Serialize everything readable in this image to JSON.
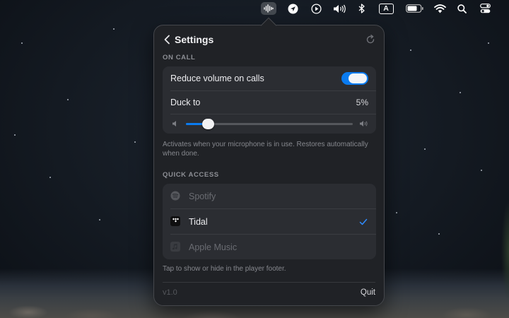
{
  "menubar": {
    "input_source": "A",
    "active_item": "audio-waveform-icon"
  },
  "popover": {
    "title": "Settings",
    "on_call": {
      "section_label": "ON CALL",
      "reduce_volume_label": "Reduce volume on calls",
      "reduce_volume_enabled": true,
      "duck_to_label": "Duck to",
      "duck_to_value": "5%",
      "duck_level_fraction": 0.13,
      "help_text": "Activates when your microphone is in use. Restores automatically when done."
    },
    "quick_access": {
      "section_label": "QUICK ACCESS",
      "items": [
        {
          "label": "Spotify",
          "enabled": false,
          "icon": "spotify-icon"
        },
        {
          "label": "Tidal",
          "enabled": true,
          "icon": "tidal-icon"
        },
        {
          "label": "Apple Music",
          "enabled": false,
          "icon": "apple-music-icon"
        }
      ],
      "help_text": "Tap to show or hide in the player footer."
    },
    "footer": {
      "version": "v1.0",
      "quit_label": "Quit"
    }
  },
  "colors": {
    "accent": "#0a7bf0",
    "popover_bg": "#202226",
    "card_bg": "#2b2d32"
  }
}
